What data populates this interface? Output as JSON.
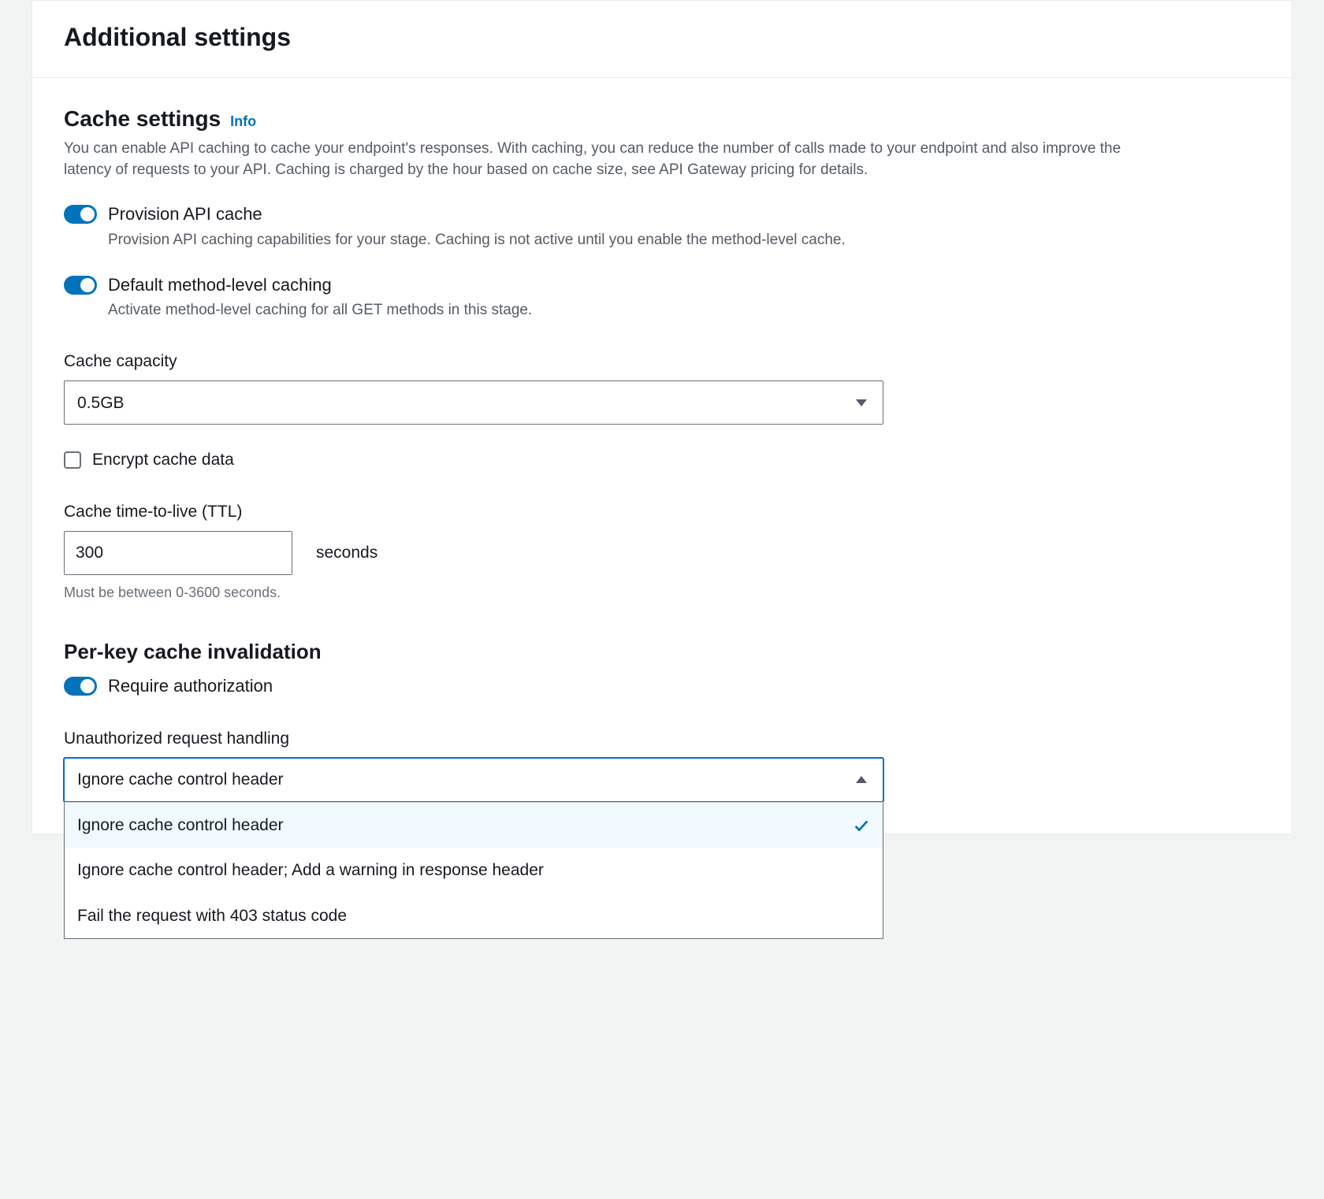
{
  "panel": {
    "title": "Additional settings"
  },
  "cache": {
    "title": "Cache settings",
    "info_label": "Info",
    "description": "You can enable API caching to cache your endpoint's responses. With caching, you can reduce the number of calls made to your endpoint and also improve the latency of requests to your API. Caching is charged by the hour based on cache size, see API Gateway pricing for details.",
    "provision": {
      "label": "Provision API cache",
      "description": "Provision API caching capabilities for your stage. Caching is not active until you enable the method-level cache."
    },
    "default_method": {
      "label": "Default method-level caching",
      "description": "Activate method-level caching for all GET methods in this stage."
    },
    "capacity": {
      "label": "Cache capacity",
      "value": "0.5GB"
    },
    "encrypt": {
      "label": "Encrypt cache data"
    },
    "ttl": {
      "label": "Cache time-to-live (TTL)",
      "value": "300",
      "unit": "seconds",
      "hint": "Must be between 0-3600 seconds."
    }
  },
  "invalidation": {
    "title": "Per-key cache invalidation",
    "require_auth": {
      "label": "Require authorization"
    },
    "unauth": {
      "label": "Unauthorized request handling",
      "value": "Ignore cache control header",
      "options": [
        "Ignore cache control header",
        "Ignore cache control header; Add a warning in response header",
        "Fail the request with 403 status code"
      ]
    }
  }
}
